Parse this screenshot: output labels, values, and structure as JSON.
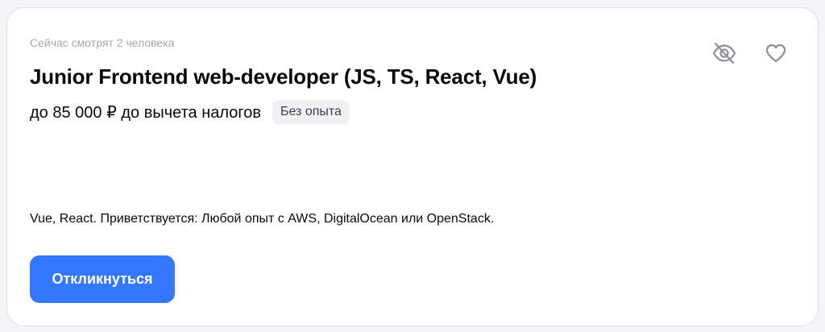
{
  "vacancy": {
    "viewers_text": "Сейчас смотрят 2 человека",
    "title": "Junior Frontend web-developer (JS, TS, React, Vue)",
    "salary": "до 85 000 ₽ до вычета налогов",
    "experience_badge": "Без опыта",
    "snippet": "Vue, React. Приветствуется: Любой опыт с AWS, DigitalOcean или OpenStack.",
    "apply_label": "Откликнуться"
  },
  "icons": {
    "hide": "eye-off-icon",
    "favorite": "heart-icon"
  },
  "colors": {
    "accent": "#3377ff",
    "muted_text": "#a3a8b3",
    "icon": "#8a8f9a",
    "badge_bg": "#f0f1f4"
  }
}
